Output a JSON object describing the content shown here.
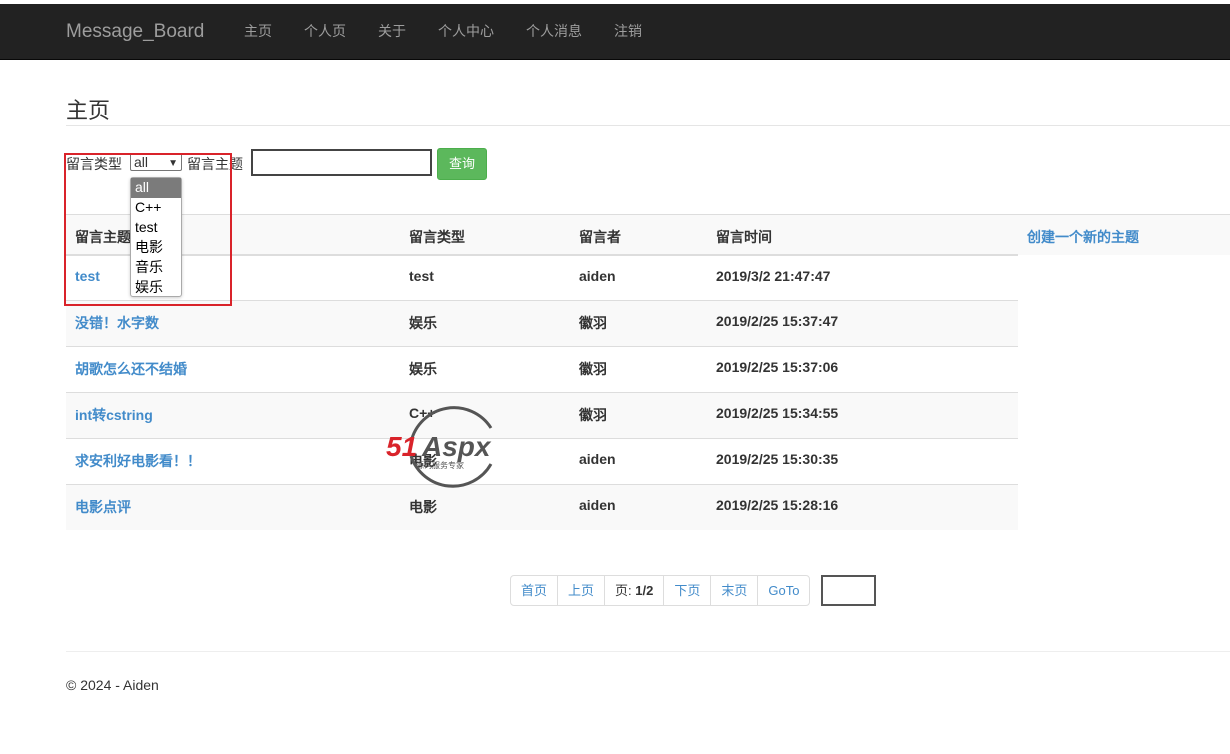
{
  "navbar": {
    "brand": "Message_Board",
    "items": [
      "主页",
      "个人页",
      "关于",
      "个人中心",
      "个人消息",
      "注销"
    ]
  },
  "page_title": "主页",
  "filter": {
    "type_label": "留言类型",
    "type_selected": "all",
    "type_options": [
      "all",
      "C++",
      "test",
      "电影",
      "音乐",
      "娱乐"
    ],
    "topic_label": "留言主题",
    "topic_value": "",
    "query_button": "查询"
  },
  "table": {
    "headers": [
      "留言主题",
      "留言类型",
      "留言者",
      "留言时间"
    ],
    "create_link": "创建一个新的主题",
    "rows": [
      {
        "topic": "test",
        "type": "test",
        "author": "aiden",
        "time": "2019/3/2 21:47:47"
      },
      {
        "topic": "没错！水字数",
        "type": "娱乐",
        "author": "徽羽",
        "time": "2019/2/25 15:37:47"
      },
      {
        "topic": "胡歌怎么还不结婚",
        "type": "娱乐",
        "author": "徽羽",
        "time": "2019/2/25 15:37:06"
      },
      {
        "topic": "int转cstring",
        "type": "C++",
        "author": "徽羽",
        "time": "2019/2/25 15:34:55"
      },
      {
        "topic": "求安利好电影看！！",
        "type": "电影",
        "author": "aiden",
        "time": "2019/2/25 15:30:35"
      },
      {
        "topic": "电影点评",
        "type": "电影",
        "author": "aiden",
        "time": "2019/2/25 15:28:16"
      }
    ]
  },
  "pager": {
    "first": "首页",
    "prev": "上页",
    "page_prefix": "页: ",
    "page_info": "1/2",
    "next": "下页",
    "last": "末页",
    "goto": "GoTo",
    "goto_value": ""
  },
  "footer": "© 2024 - Aiden",
  "watermark": {
    "brand": "51Aspx",
    "tagline": "源码服务专家",
    "colors": {
      "red": "#d9232a",
      "green": "#5aa83c",
      "gray": "#555555"
    }
  }
}
